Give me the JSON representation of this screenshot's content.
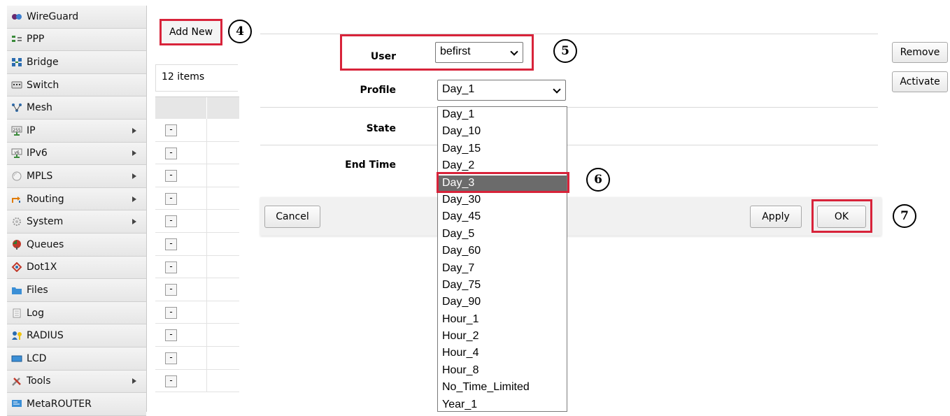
{
  "sidebar": {
    "items": [
      {
        "label": "WireGuard",
        "icon": "wireguard-icon",
        "submenu": false
      },
      {
        "label": "PPP",
        "icon": "ppp-icon",
        "submenu": false
      },
      {
        "label": "Bridge",
        "icon": "bridge-icon",
        "submenu": false
      },
      {
        "label": "Switch",
        "icon": "switch-icon",
        "submenu": false
      },
      {
        "label": "Mesh",
        "icon": "mesh-icon",
        "submenu": false
      },
      {
        "label": "IP",
        "icon": "ip-icon",
        "icon_text": "255",
        "submenu": true
      },
      {
        "label": "IPv6",
        "icon": "ipv6-icon",
        "icon_text": "v6",
        "submenu": true
      },
      {
        "label": "MPLS",
        "icon": "mpls-icon",
        "submenu": true
      },
      {
        "label": "Routing",
        "icon": "routing-icon",
        "submenu": true
      },
      {
        "label": "System",
        "icon": "system-gear-icon",
        "submenu": true
      },
      {
        "label": "Queues",
        "icon": "queues-icon",
        "submenu": false
      },
      {
        "label": "Dot1X",
        "icon": "dot1x-icon",
        "submenu": false
      },
      {
        "label": "Files",
        "icon": "folder-icon",
        "submenu": false
      },
      {
        "label": "Log",
        "icon": "log-icon",
        "submenu": false
      },
      {
        "label": "RADIUS",
        "icon": "radius-icon",
        "submenu": false
      },
      {
        "label": "LCD",
        "icon": "lcd-icon",
        "submenu": false
      },
      {
        "label": "Tools",
        "icon": "tools-icon",
        "submenu": true
      },
      {
        "label": "MetaROUTER",
        "icon": "metarouter-icon",
        "submenu": false
      }
    ]
  },
  "list": {
    "add_new_label": "Add New",
    "items_count": "12 items",
    "row_count": 12,
    "collapse_symbol": "-"
  },
  "form": {
    "user_label": "User",
    "user_value": "befirst",
    "profile_label": "Profile",
    "profile_value": "Day_1",
    "state_label": "State",
    "end_time_label": "End Time"
  },
  "side_buttons": {
    "remove_label": "Remove",
    "activate_label": "Activate"
  },
  "actions": {
    "cancel_label": "Cancel",
    "apply_label": "Apply",
    "ok_label": "OK"
  },
  "dropdown": {
    "options": [
      "Day_1",
      "Day_10",
      "Day_15",
      "Day_2",
      "Day_3",
      "Day_30",
      "Day_45",
      "Day_5",
      "Day_60",
      "Day_7",
      "Day_75",
      "Day_90",
      "Hour_1",
      "Hour_2",
      "Hour_4",
      "Hour_8",
      "No_Time_Limited",
      "Year_1"
    ],
    "highlighted": "Day_3"
  },
  "callouts": {
    "step4": "4",
    "step5": "5",
    "step6": "6",
    "step7": "7"
  },
  "colors": {
    "highlight": "#d8233a",
    "selected_option": "#6b6b6b"
  }
}
